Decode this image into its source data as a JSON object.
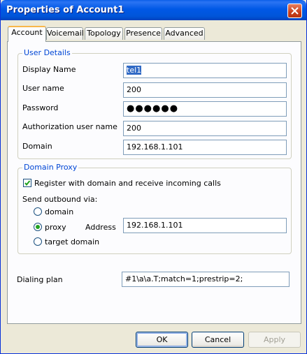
{
  "window": {
    "title": "Properties of Account1"
  },
  "tabs": [
    {
      "label": "Account"
    },
    {
      "label": "Voicemail"
    },
    {
      "label": "Topology"
    },
    {
      "label": "Presence"
    },
    {
      "label": "Advanced"
    }
  ],
  "user_details": {
    "legend": "User Details",
    "display_name_label": "Display Name",
    "display_name_value": "tel1",
    "user_name_label": "User name",
    "user_name_value": "200",
    "password_label": "Password",
    "password_value": "●●●●●●",
    "auth_user_label": "Authorization user name",
    "auth_user_value": "200",
    "domain_label": "Domain",
    "domain_value": "192.168.1.101"
  },
  "domain_proxy": {
    "legend": "Domain Proxy",
    "register_label": "Register with domain and receive incoming calls",
    "register_checked": true,
    "send_outbound_label": "Send outbound via:",
    "option_domain": "domain",
    "option_proxy": "proxy",
    "option_target": "target domain",
    "selected": "proxy",
    "address_label": "Address",
    "address_value": "192.168.1.101"
  },
  "dialing_plan": {
    "label": "Dialing plan",
    "value": "#1\\a\\a.T;match=1;prestrip=2;"
  },
  "buttons": {
    "ok": "OK",
    "cancel": "Cancel",
    "apply": "Apply"
  }
}
